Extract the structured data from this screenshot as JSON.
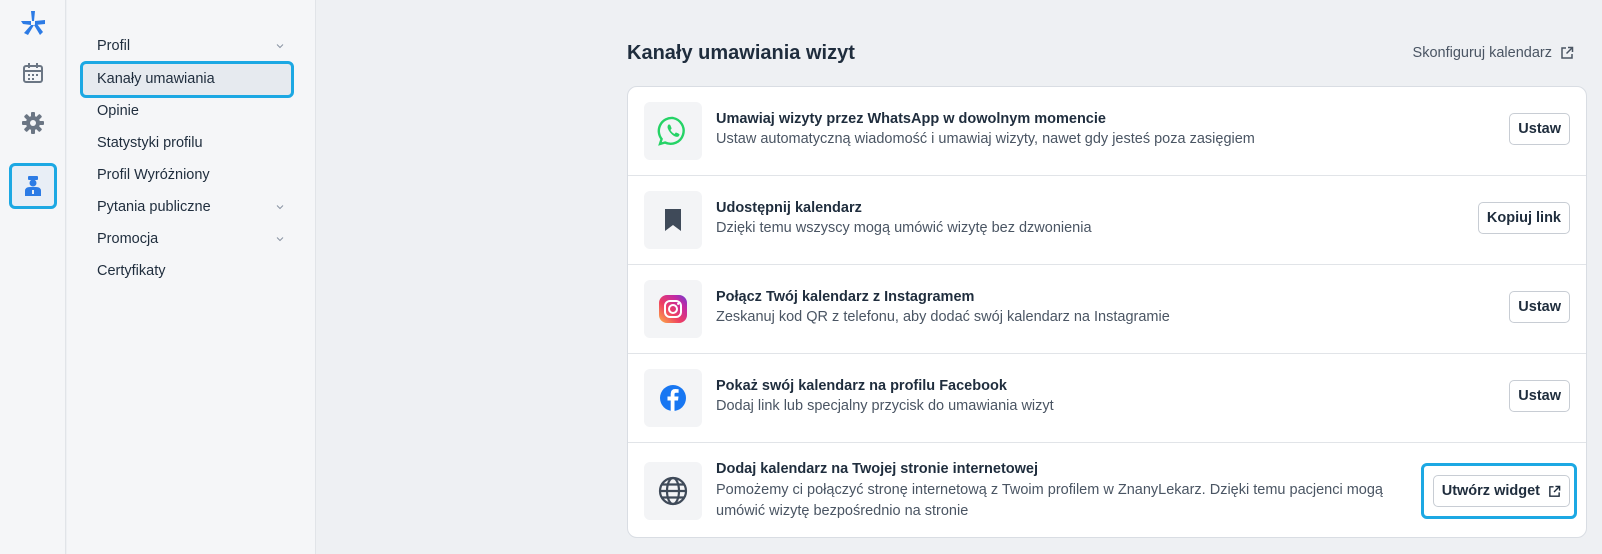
{
  "rail": {
    "items": [
      {
        "icon": "logo-icon"
      },
      {
        "icon": "calendar-icon"
      },
      {
        "icon": "gear-icon"
      },
      {
        "icon": "doctor-profile-icon"
      }
    ]
  },
  "subnav": {
    "items": [
      {
        "label": "Profil",
        "has_chevron": true
      },
      {
        "label": "Kanały umawiania",
        "has_chevron": false
      },
      {
        "label": "Opinie",
        "has_chevron": false
      },
      {
        "label": "Statystyki profilu",
        "has_chevron": false
      },
      {
        "label": "Profil Wyróżniony",
        "has_chevron": false
      },
      {
        "label": "Pytania publiczne",
        "has_chevron": true
      },
      {
        "label": "Promocja",
        "has_chevron": true
      },
      {
        "label": "Certyfikaty",
        "has_chevron": false
      }
    ]
  },
  "main": {
    "title": "Kanały umawiania wizyt",
    "config_link": "Skonfiguruj kalendarz",
    "channels": [
      {
        "icon": "whatsapp-icon",
        "title": "Umawiaj wizyty przez WhatsApp w dowolnym momencie",
        "desc": "Ustaw automatyczną wiadomość i umawiaj wizyty, nawet gdy jesteś poza zasięgiem",
        "button": "Ustaw"
      },
      {
        "icon": "bookmark-icon",
        "title": "Udostępnij kalendarz",
        "desc": "Dzięki temu wszyscy mogą umówić wizytę bez dzwonienia",
        "button": "Kopiuj link"
      },
      {
        "icon": "instagram-icon",
        "title": "Połącz Twój kalendarz z Instagramem",
        "desc": "Zeskanuj kod QR z telefonu, aby dodać swój kalendarz na Instagramie",
        "button": "Ustaw"
      },
      {
        "icon": "facebook-icon",
        "title": "Pokaż swój kalendarz na profilu Facebook",
        "desc": "Dodaj link lub specjalny przycisk do umawiania wizyt",
        "button": "Ustaw"
      },
      {
        "icon": "globe-icon",
        "title": "Dodaj kalendarz na Twojej stronie internetowej",
        "desc": "Pomożemy ci połączyć stronę internetową z Twoim profilem w ZnanyLekarz. Dzięki temu pacjenci mogą umówić wizytę bezpośrednio na stronie",
        "button": "Utwórz widget"
      }
    ]
  },
  "colors": {
    "accent_highlight": "#1ca8e3",
    "brand": "#2c7be5",
    "whatsapp": "#25d366",
    "facebook": "#1877f2"
  }
}
